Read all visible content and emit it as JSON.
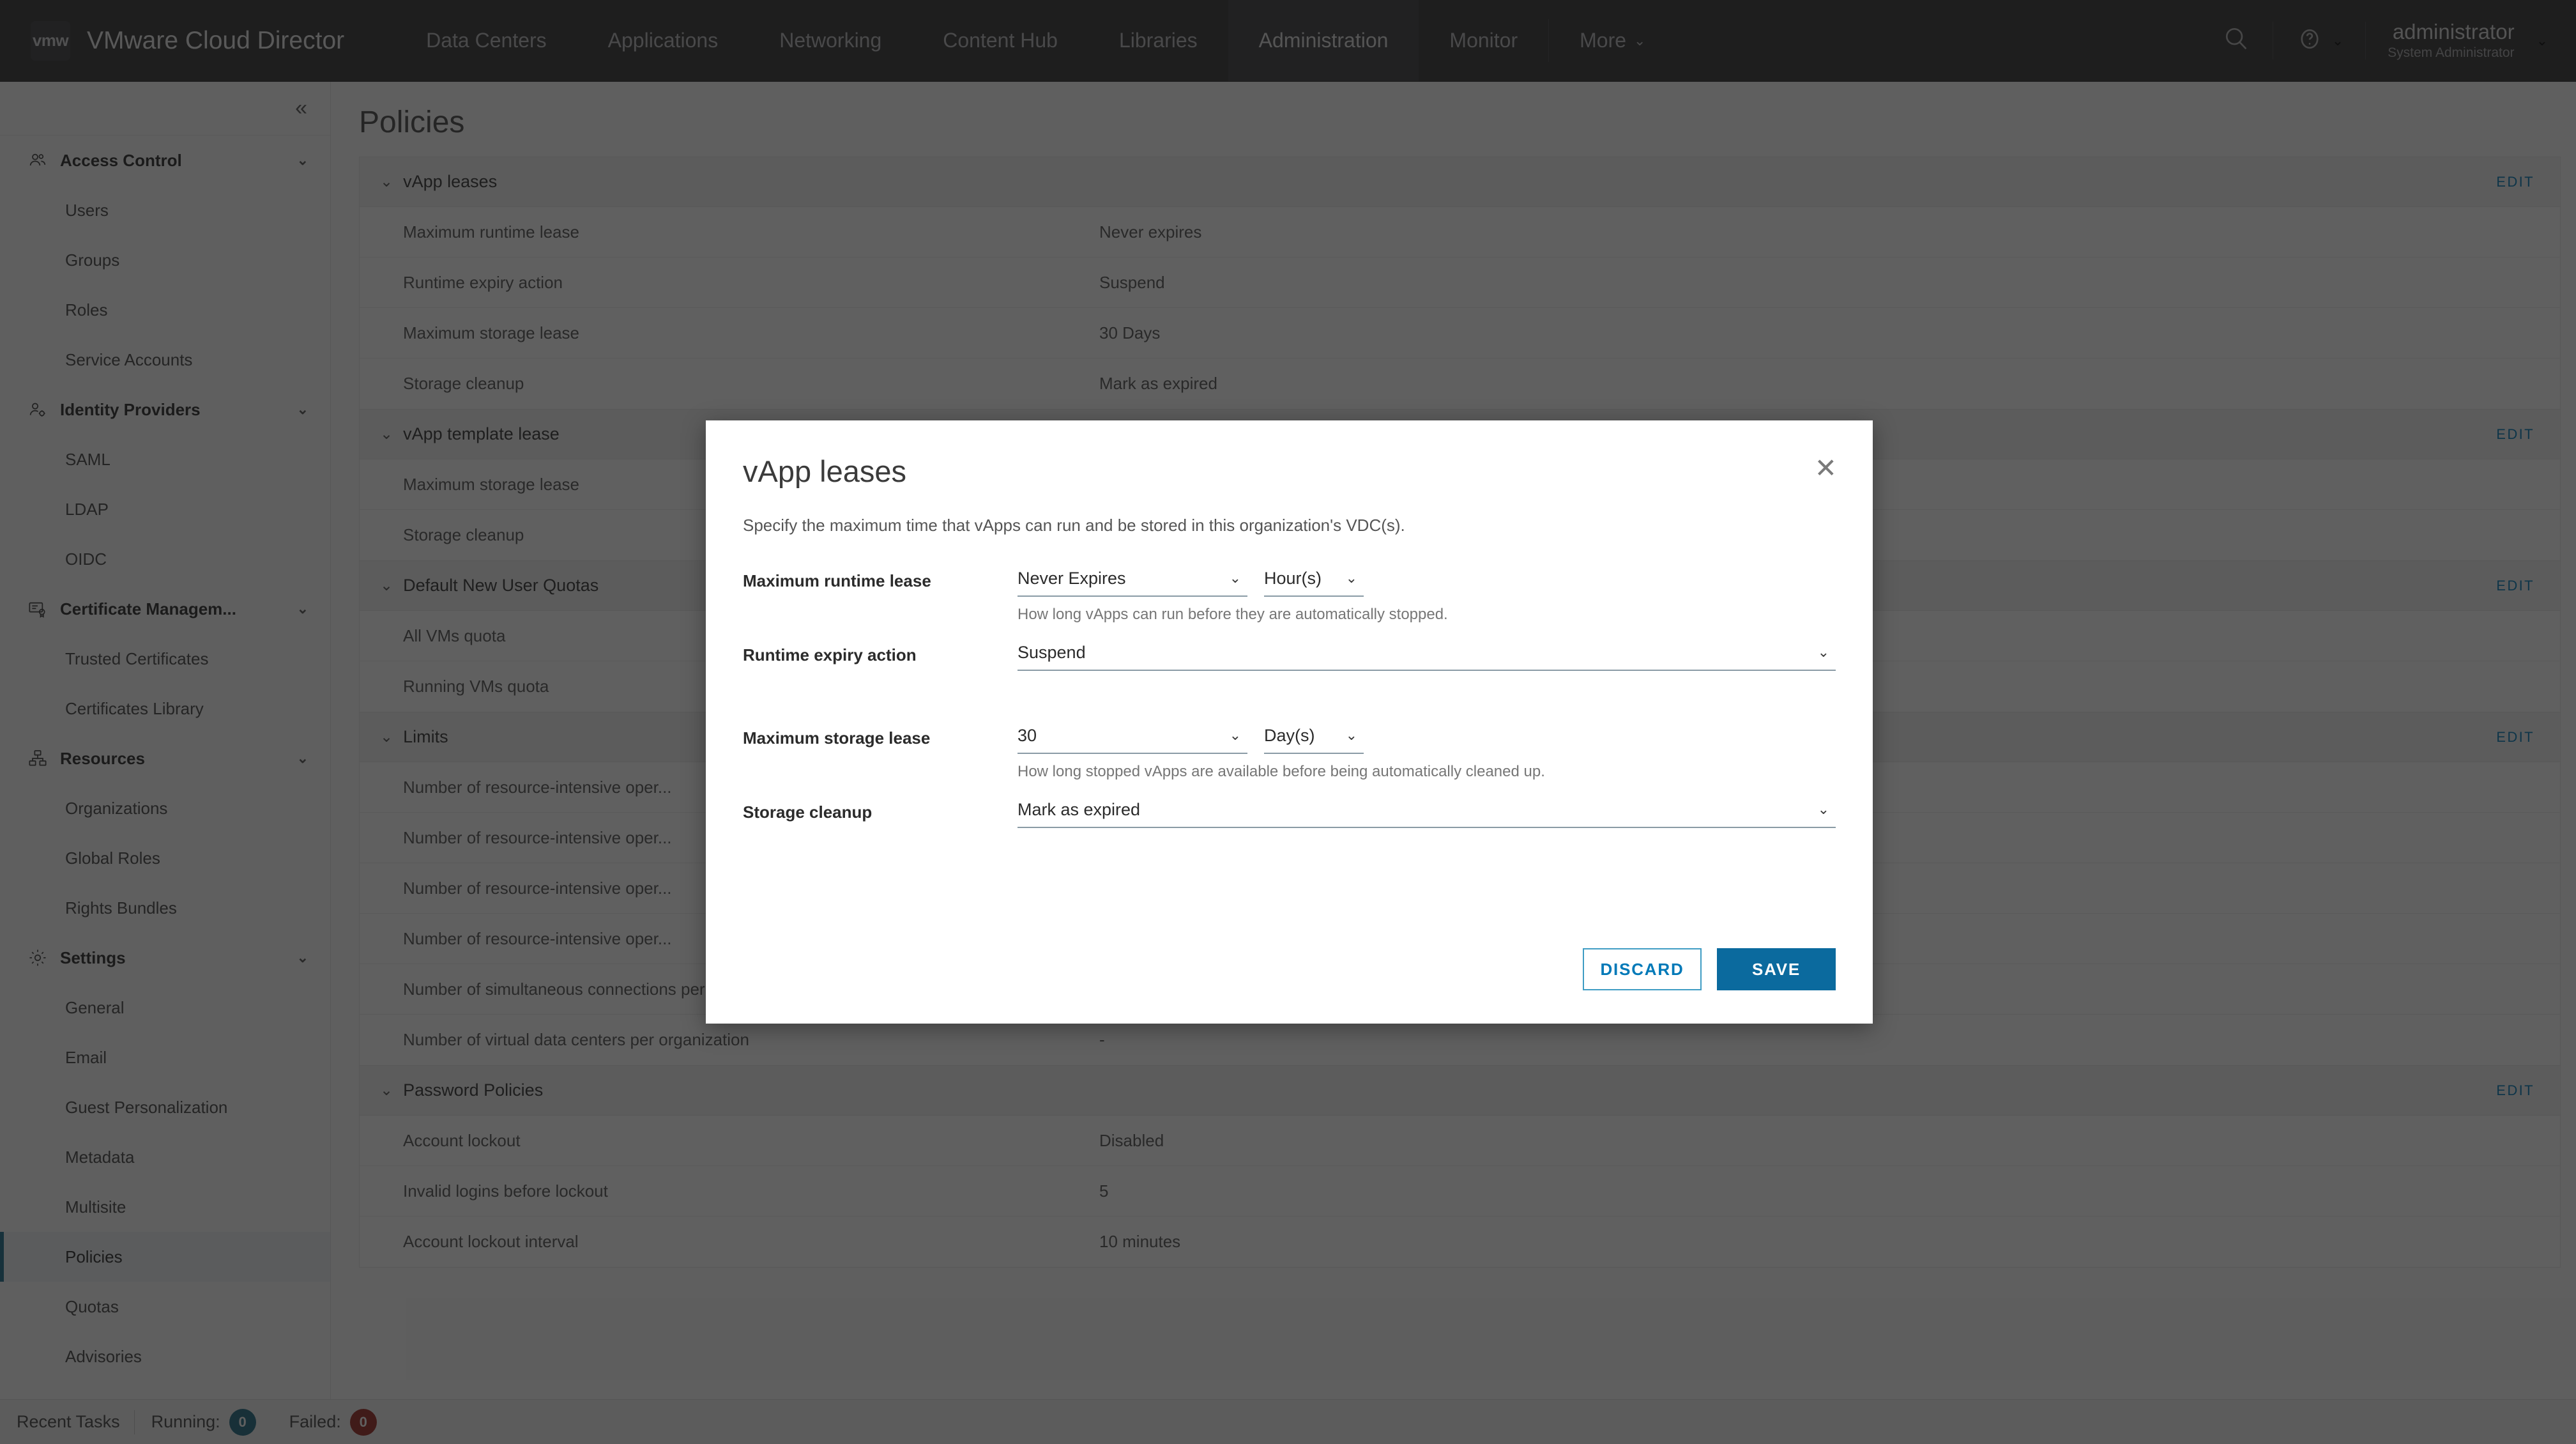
{
  "header": {
    "logo_text": "vmw",
    "product_title": "VMware Cloud Director",
    "nav": [
      {
        "label": "Data Centers",
        "active": false
      },
      {
        "label": "Applications",
        "active": false
      },
      {
        "label": "Networking",
        "active": false
      },
      {
        "label": "Content Hub",
        "active": false
      },
      {
        "label": "Libraries",
        "active": false
      },
      {
        "label": "Administration",
        "active": true
      },
      {
        "label": "Monitor",
        "active": false
      }
    ],
    "more_label": "More",
    "more_caret": "⌄",
    "search_icon": "search-icon",
    "help_icon": "help-icon",
    "help_caret": "⌄",
    "user_name": "administrator",
    "user_role": "System Administrator",
    "user_caret": "⌄"
  },
  "sidebar": {
    "collapse_icon": "«",
    "groups": [
      {
        "label": "Access Control",
        "icon": "users-group-icon",
        "chevron": "⌄",
        "items": [
          "Users",
          "Groups",
          "Roles",
          "Service Accounts"
        ]
      },
      {
        "label": "Identity Providers",
        "icon": "user-gear-icon",
        "chevron": "⌄",
        "items": [
          "SAML",
          "LDAP",
          "OIDC"
        ]
      },
      {
        "label": "Certificate Managem...",
        "icon": "certificate-icon",
        "chevron": "⌄",
        "items": [
          "Trusted Certificates",
          "Certificates Library"
        ]
      },
      {
        "label": "Resources",
        "icon": "nodes-icon",
        "chevron": "⌄",
        "items": [
          "Organizations",
          "Global Roles",
          "Rights Bundles"
        ]
      },
      {
        "label": "Settings",
        "icon": "gear-icon",
        "chevron": "⌄",
        "items": [
          "General",
          "Email",
          "Guest Personalization",
          "Metadata",
          "Multisite",
          "Policies",
          "Quotas",
          "Advisories"
        ]
      }
    ],
    "selected_item": "Policies"
  },
  "main": {
    "page_title": "Policies",
    "edit_label": "EDIT",
    "section_chevron": "⌄",
    "sections": [
      {
        "title": "vApp leases",
        "has_edit": true,
        "rows": [
          {
            "label": "Maximum runtime lease",
            "value": "Never expires"
          },
          {
            "label": "Runtime expiry action",
            "value": "Suspend"
          },
          {
            "label": "Maximum storage lease",
            "value": "30 Days"
          },
          {
            "label": "Storage cleanup",
            "value": "Mark as expired"
          }
        ]
      },
      {
        "title": "vApp template lease",
        "has_edit": true,
        "rows": [
          {
            "label": "Maximum storage lease",
            "value": ""
          },
          {
            "label": "Storage cleanup",
            "value": ""
          }
        ]
      },
      {
        "title": "Default New User Quotas",
        "has_edit": true,
        "rows": [
          {
            "label": "All VMs quota",
            "value": ""
          },
          {
            "label": "Running VMs quota",
            "value": ""
          }
        ]
      },
      {
        "title": "Limits",
        "has_edit": true,
        "rows": [
          {
            "label": "Number of resource-intensive oper...",
            "value": ""
          },
          {
            "label": "Number of resource-intensive oper...",
            "value": ""
          },
          {
            "label": "Number of resource-intensive oper...",
            "value": ""
          },
          {
            "label": "Number of resource-intensive oper...",
            "value": ""
          },
          {
            "label": "Number of simultaneous connections per VM",
            "value": "-"
          },
          {
            "label": "Number of virtual data centers per organization",
            "value": "-"
          }
        ]
      },
      {
        "title": "Password Policies",
        "has_edit": true,
        "rows": [
          {
            "label": "Account lockout",
            "value": "Disabled"
          },
          {
            "label": "Invalid logins before lockout",
            "value": "5"
          },
          {
            "label": "Account lockout interval",
            "value": "10 minutes"
          }
        ]
      }
    ]
  },
  "modal": {
    "title": "vApp leases",
    "close_icon": "✕",
    "description": "Specify the maximum time that vApps can run and be stored in this organization's VDC(s).",
    "chevron": "⌄",
    "fields": [
      {
        "label": "Maximum runtime lease",
        "value": "Never Expires",
        "unit": "Hour(s)",
        "hint": "How long vApps can run before they are automatically stopped.",
        "layout": "value-unit"
      },
      {
        "label": "Runtime expiry action",
        "value": "Suspend",
        "unit": null,
        "hint": "",
        "layout": "wide"
      },
      {
        "label": "Maximum storage lease",
        "value": "30",
        "unit": "Day(s)",
        "hint": "How long stopped vApps are available before being automatically cleaned up.",
        "layout": "value-unit"
      },
      {
        "label": "Storage cleanup",
        "value": "Mark as expired",
        "unit": null,
        "hint": "",
        "layout": "wide"
      }
    ],
    "discard_label": "DISCARD",
    "save_label": "SAVE"
  },
  "footer": {
    "recent_tasks_label": "Recent Tasks",
    "running_label": "Running:",
    "running_count": "0",
    "failed_label": "Failed:",
    "failed_count": "0"
  },
  "colors": {
    "accent": "#0079b8",
    "primary_button": "#0b6a9e",
    "header_bg": "#323234",
    "running_badge": "#1f6b84",
    "failed_badge": "#9c2b22"
  }
}
